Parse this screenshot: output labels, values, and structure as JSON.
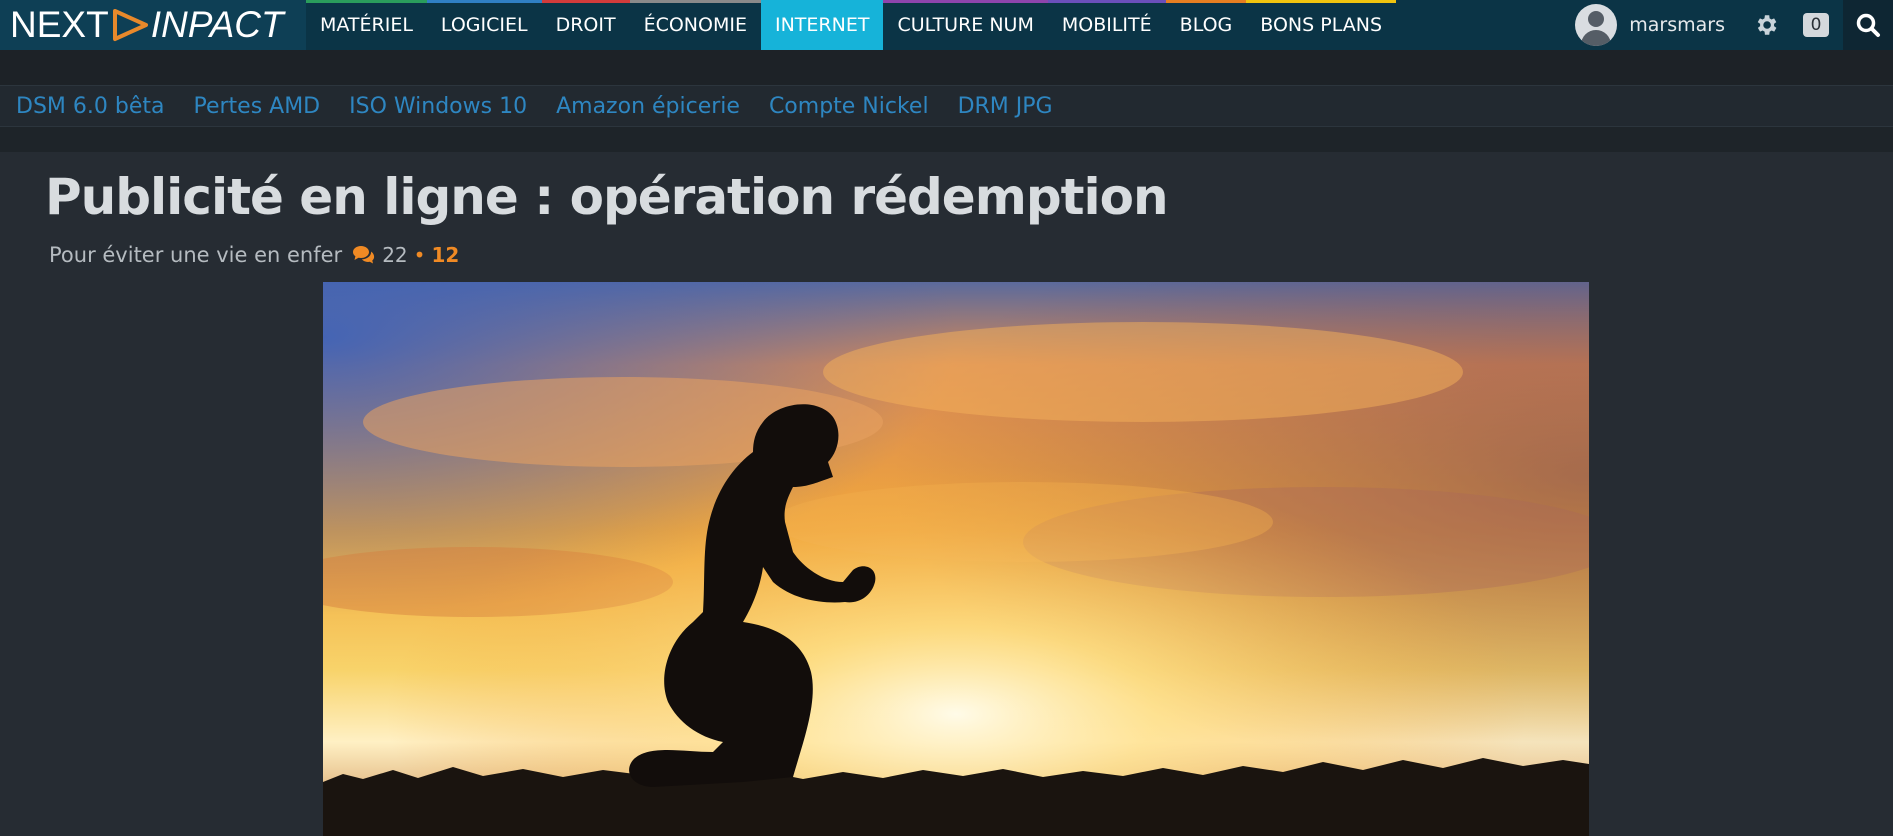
{
  "logo": {
    "left": "NEXT",
    "right": "INPACT"
  },
  "nav": {
    "items": [
      {
        "label": "MATÉRIEL",
        "color": "#2a9d5c",
        "active": false
      },
      {
        "label": "LOGICIEL",
        "color": "#2f7fc4",
        "active": false
      },
      {
        "label": "DROIT",
        "color": "#d23b3b",
        "active": false
      },
      {
        "label": "ÉCONOMIE",
        "color": "#8a8a8a",
        "active": false
      },
      {
        "label": "INTERNET",
        "color": "#16b3d9",
        "active": true
      },
      {
        "label": "CULTURE NUM",
        "color": "#8e44ad",
        "active": false
      },
      {
        "label": "MOBILITÉ",
        "color": "#6b4fbb",
        "active": false
      },
      {
        "label": "BLOG",
        "color": "#e67e22",
        "active": false
      },
      {
        "label": "BONS PLANS",
        "color": "#f1c40f",
        "active": false
      }
    ]
  },
  "user": {
    "name": "marsmars",
    "notifications": "0"
  },
  "tags": [
    "DSM 6.0 bêta",
    "Pertes AMD",
    "ISO Windows 10",
    "Amazon épicerie",
    "Compte Nickel",
    "DRM JPG"
  ],
  "article": {
    "title": "Publicité en ligne : opération rédemption",
    "subtitle": "Pour éviter une vie en enfer",
    "comments": "22",
    "separator": "•",
    "new_comments": "12"
  },
  "colors": {
    "accent": "#16b3d9",
    "orange": "#f08a24",
    "tag": "#2e86c1"
  }
}
